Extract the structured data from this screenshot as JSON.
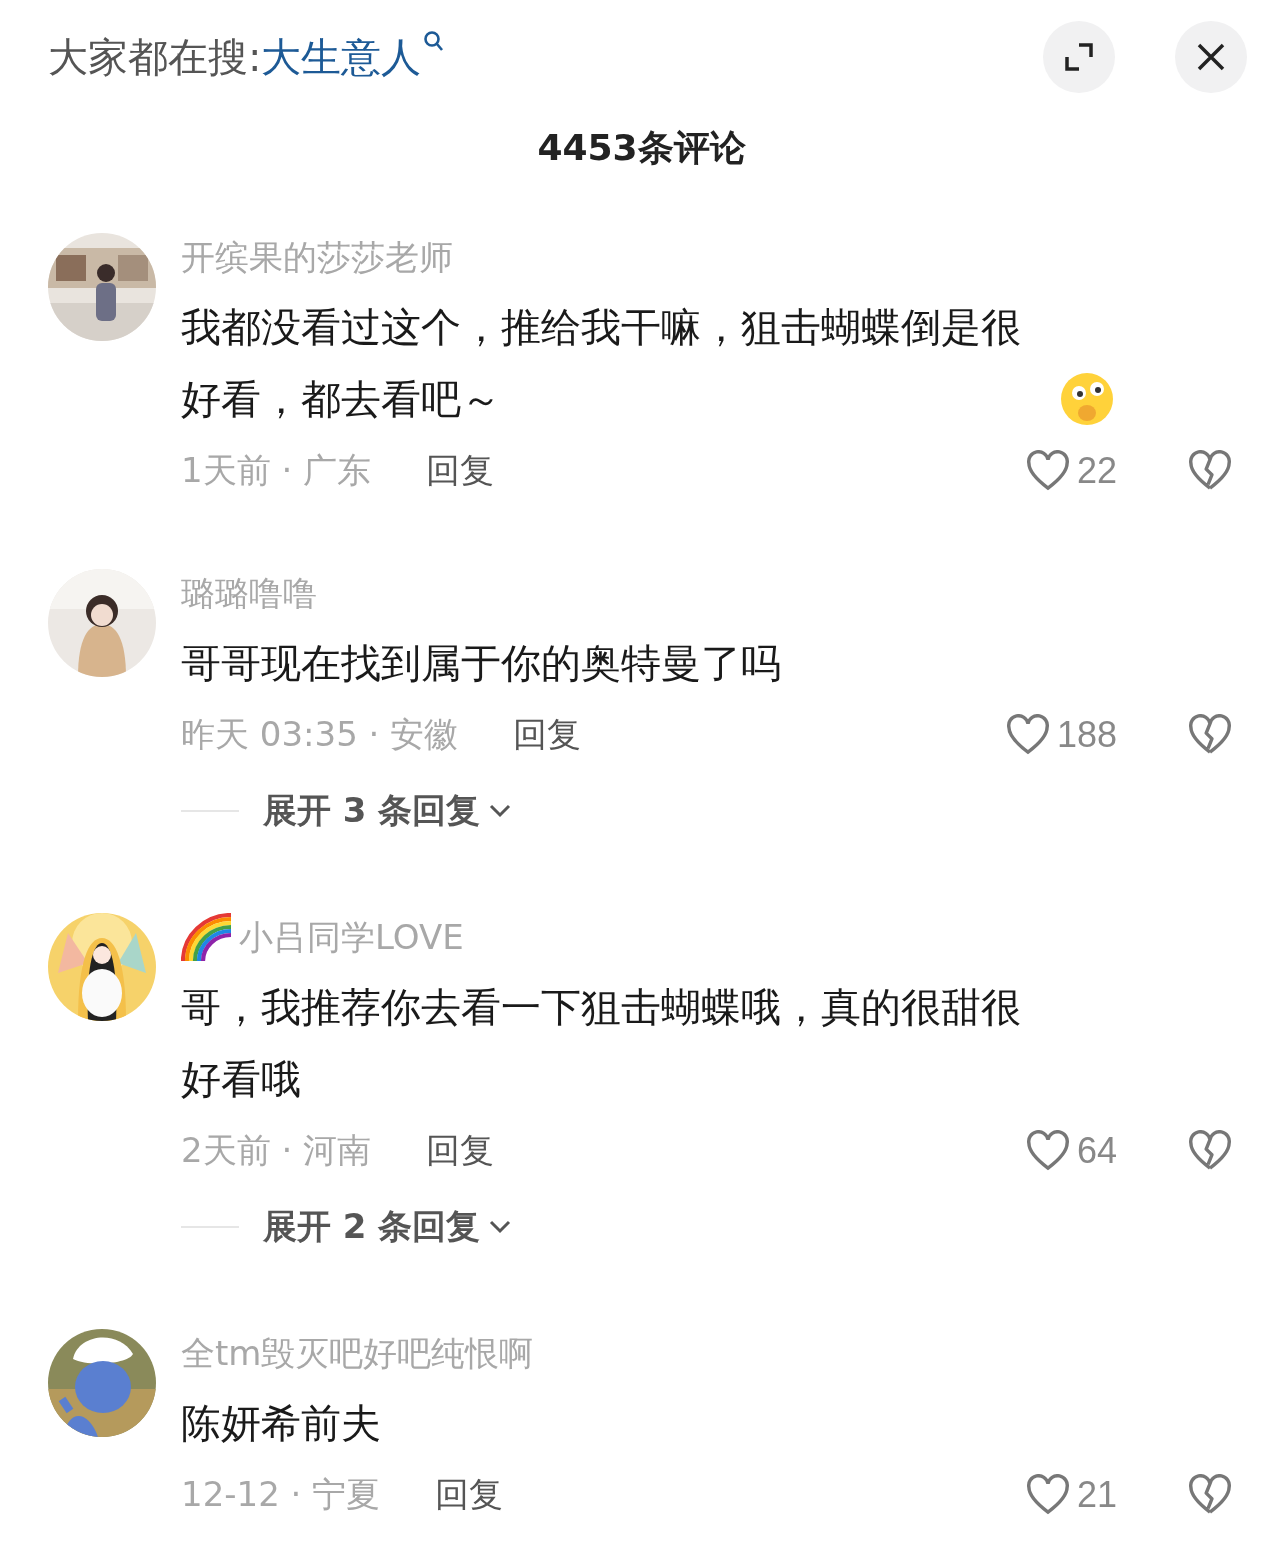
{
  "search_bar": {
    "label": "大家都在搜:",
    "query": "大生意人"
  },
  "comment_count": "4453条评论",
  "comments": [
    {
      "username": "开缤果的莎莎老师",
      "name_badge": false,
      "text": "我都没看过这个，推给我干嘛，狙击蝴蝶倒是很好看，都去看吧～",
      "emoji": true,
      "time_location": "1天前 · 广东",
      "reply": "回复",
      "likes": "22"
    },
    {
      "username": "璐璐噜噜",
      "name_badge": false,
      "text": "哥哥现在找到属于你的奥特曼了吗",
      "emoji": false,
      "time_location": "昨天 03:35 · 安徽",
      "reply": "回复",
      "likes": "188",
      "expand": "展开 3 条回复"
    },
    {
      "username": "小吕同学LOVE",
      "name_badge": true,
      "text": "哥，我推荐你去看一下狙击蝴蝶哦，真的很甜很好看哦",
      "emoji": false,
      "time_location": "2天前 · 河南",
      "reply": "回复",
      "likes": "64",
      "expand": "展开 2 条回复"
    },
    {
      "username": "全tm毁灭吧好吧纯恨啊",
      "name_badge": false,
      "text": "陈妍希前夫",
      "emoji": false,
      "time_location": "12-12 · 宁夏",
      "reply": "回复",
      "likes": "21"
    }
  ]
}
